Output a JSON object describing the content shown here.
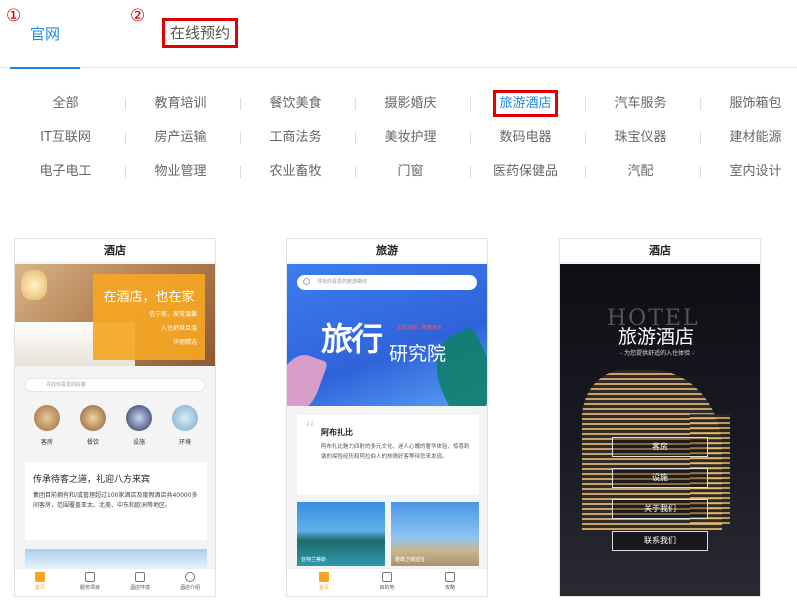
{
  "annotations": {
    "n1": "①",
    "n2": "②"
  },
  "tabs": {
    "official": "官网",
    "booking": "在线预约"
  },
  "categories": [
    [
      "全部",
      "教育培训",
      "餐饮美食",
      "摄影婚庆",
      "旅游酒店",
      "汽车服务",
      "服饰箱包"
    ],
    [
      "IT互联网",
      "房产运输",
      "工商法务",
      "美妆护理",
      "数码电器",
      "珠宝仪器",
      "建材能源"
    ],
    [
      "电子电工",
      "物业管理",
      "农业畜牧",
      "门窗",
      "医药保健品",
      "汽配",
      "室内设计"
    ]
  ],
  "active_category": "旅游酒店",
  "card1": {
    "title": "酒店",
    "hero_heading": "在酒店，也在家",
    "hero_lines": [
      "信宁居、家常温馨",
      "入住舒爽且温",
      "华丽精选"
    ],
    "search_placeholder": "寻找你喜爱的好客",
    "icons": [
      "客房",
      "餐饮",
      "设施",
      "环境"
    ],
    "info_heading": "传承待客之道，礼迎八方来宾",
    "info_text": "集团目前拥有和/或管理超过100家酒店及度假酒店共40000多间客房，范围覆盖亚太、北美、中东和欧洲等地区。",
    "nav": [
      "首页",
      "服务项目",
      "酒店环境",
      "酒店介绍"
    ]
  },
  "card2": {
    "title": "旅游",
    "search_placeholder": "寻找你喜爱的旅游路线",
    "hero_big": "旅行",
    "hero_big2": "研究院",
    "hero_tag": "出发在即，跟着未来",
    "info_heading": "阿布扎比",
    "info_text": "阿布扎比魅力四射的多元文化、迷人心魄的奢华体验、惊喜刺激的探险经历和阿拉伯人的热情好客等待您来发现。",
    "img1_caption": "亚特兰蒂斯",
    "img2_caption": "雅典卫城遗址",
    "nav": [
      "首页",
      "目的地",
      "攻略"
    ]
  },
  "card3": {
    "title": "酒店",
    "hotel_word": "HOTEL",
    "hero_title": "旅游酒店",
    "hero_sub": "- 为您提供舒适的入住体验 -",
    "buttons": [
      "客房",
      "设施",
      "关于我们",
      "联系我们"
    ]
  },
  "colors": {
    "accent": "#1e88e5",
    "highlight": "#e00000",
    "orange": "#f5a623"
  }
}
